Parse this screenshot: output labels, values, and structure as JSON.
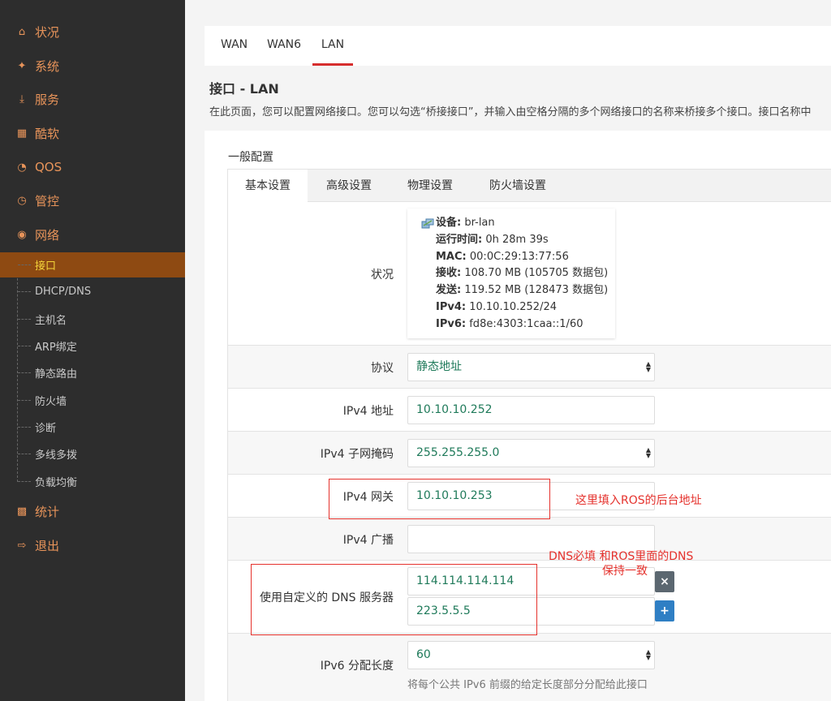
{
  "sidebar": {
    "menu": [
      {
        "label": "状况",
        "icon": "home-icon"
      },
      {
        "label": "系统",
        "icon": "tools-icon"
      },
      {
        "label": "服务",
        "icon": "download-icon"
      },
      {
        "label": "酷软",
        "icon": "calendar-icon"
      },
      {
        "label": "QOS",
        "icon": "speedometer-icon"
      },
      {
        "label": "管控",
        "icon": "clock-icon"
      },
      {
        "label": "网络",
        "icon": "globe-icon"
      }
    ],
    "submenu": [
      "接口",
      "DHCP/DNS",
      "主机名",
      "ARP绑定",
      "静态路由",
      "防火墙",
      "诊断",
      "多线多拨",
      "负载均衡"
    ],
    "bottom_menu": [
      {
        "label": "统计",
        "icon": "bar-chart-icon"
      },
      {
        "label": "退出",
        "icon": "logout-icon"
      }
    ]
  },
  "top_tabs": [
    "WAN",
    "WAN6",
    "LAN"
  ],
  "page": {
    "title": "接口 - LAN",
    "description": "在此页面，您可以配置网络接口。您可以勾选“桥接接口”，并输入由空格分隔的多个网络接口的名称来桥接多个接口。接口名称中"
  },
  "section_title": "一般配置",
  "tabs": [
    "基本设置",
    "高级设置",
    "物理设置",
    "防火墙设置"
  ],
  "status": {
    "label": "状况",
    "lines": [
      {
        "key": "设备",
        "value": "br-lan"
      },
      {
        "key": "运行时间",
        "value": "0h 28m 39s"
      },
      {
        "key": "MAC",
        "value": "00:0C:29:13:77:56"
      },
      {
        "key": "接收",
        "value": "108.70 MB (105705 数据包)"
      },
      {
        "key": "发送",
        "value": "119.52 MB (128473 数据包)"
      },
      {
        "key": "IPv4",
        "value": "10.10.10.252/24"
      },
      {
        "key": "IPv6",
        "value": "fd8e:4303:1caa::1/60"
      }
    ]
  },
  "form": {
    "protocol": {
      "label": "协议",
      "value": "静态地址"
    },
    "ipv4_address": {
      "label": "IPv4 地址",
      "value": "10.10.10.252"
    },
    "ipv4_netmask": {
      "label": "IPv4 子网掩码",
      "value": "255.255.255.0"
    },
    "ipv4_gateway": {
      "label": "IPv4 网关",
      "value": "10.10.10.253"
    },
    "ipv4_broadcast": {
      "label": "IPv4 广播",
      "value": ""
    },
    "dns": {
      "label": "使用自定义的 DNS 服务器",
      "values": [
        "114.114.114.114",
        "223.5.5.5"
      ],
      "remove": "×",
      "add": "+"
    },
    "ipv6_prefix": {
      "label": "IPv6 分配长度",
      "value": "60",
      "hint": "将每个公共 IPv6 前缀的给定长度部分分配给此接口"
    }
  },
  "annotations": {
    "gateway_note": "这里填入ROS的后台地址",
    "dns_note_1": "DNS必填 和ROS里面的DNS",
    "dns_note_2": "保持一致"
  },
  "colors": {
    "sidebar_bg": "#2d2d2d",
    "menu_accent": "#e8945a",
    "active_sub_bg": "#8e4a12",
    "active_sub_text": "#f5d53a",
    "tab_underline": "#d62d2d",
    "input_value": "#1f7a5a",
    "annotation": "#e5322d",
    "add_button": "#2f7fc4",
    "remove_button": "#5b6770"
  }
}
